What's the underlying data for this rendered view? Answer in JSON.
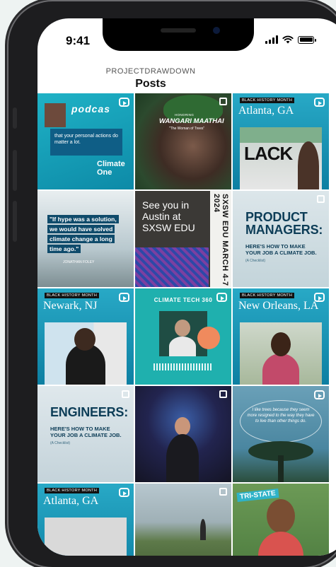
{
  "status_bar": {
    "time": "9:41"
  },
  "header": {
    "account": "PROJECTDRAWDOWN",
    "title": "Posts"
  },
  "posts": [
    {
      "type": "reel",
      "brand": "podcas",
      "quote": "that your personal actions do matter a lot.",
      "footer": "Climate One"
    },
    {
      "type": "carousel",
      "kicker": "HONORING",
      "name": "WANGARI MAATHAI",
      "tag": "\"The Woman of Trees\""
    },
    {
      "type": "reel",
      "badge": "BLACK HISTORY MONTH",
      "city": "Atlanta, GA"
    },
    {
      "type": "image",
      "quote_lines": [
        "\"If hype was a solution,",
        "we would have solved",
        "climate change a long",
        "time ago.\""
      ],
      "credit": "JONATHAN FOLEY"
    },
    {
      "type": "image",
      "heading": "See you in Austin at SXSW EDU",
      "side_text": "SXSW EDU MARCH 4-7 2024"
    },
    {
      "type": "carousel",
      "title_lines": [
        "PRODUCT",
        "MANAGERS:"
      ],
      "sub_lines": [
        "HERE'S HOW TO MAKE",
        "YOUR JOB A CLIMATE JOB."
      ],
      "note": "(A Checklist)"
    },
    {
      "type": "reel",
      "badge": "BLACK HISTORY MONTH",
      "city": "Newark, NJ"
    },
    {
      "type": "reel",
      "label": "CLIMATE TECH 360"
    },
    {
      "type": "reel",
      "badge": "BLACK HISTORY MONTH",
      "city": "New Orleans, LA"
    },
    {
      "type": "carousel",
      "title_lines": [
        "ENGINEERS:"
      ],
      "sub_lines": [
        "HERE'S HOW TO MAKE",
        "YOUR JOB A CLIMATE JOB."
      ],
      "note": "(A Checklist)"
    },
    {
      "type": "carousel"
    },
    {
      "type": "reel",
      "quote": "I like trees because they seem more resigned to the way they have to live than other things do."
    },
    {
      "type": "reel",
      "badge": "BLACK HISTORY MONTH",
      "city": "Atlanta, GA"
    },
    {
      "type": "carousel"
    },
    {
      "type": "image",
      "banner": "TRI-STATE"
    }
  ]
}
